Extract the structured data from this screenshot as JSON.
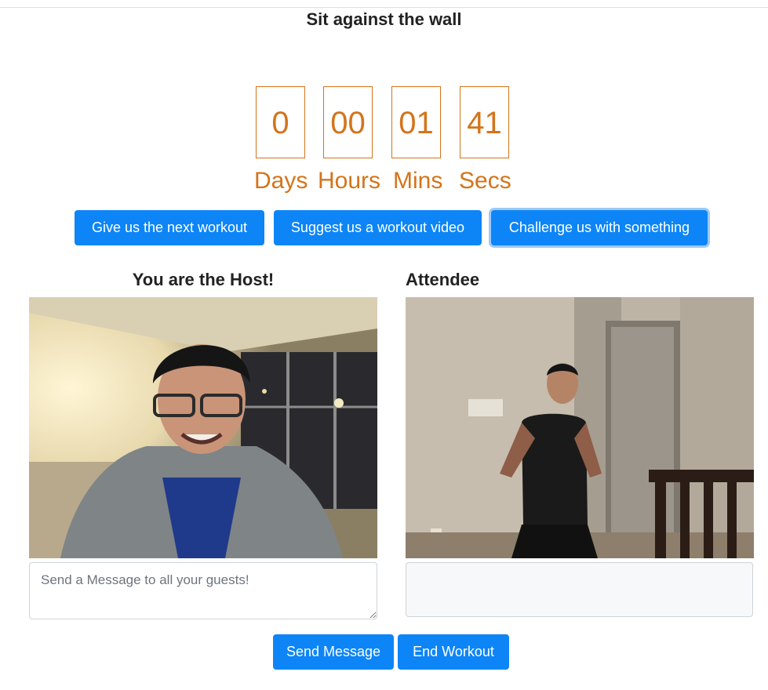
{
  "page": {
    "title": "Sit against the wall"
  },
  "countdown": {
    "days": "0",
    "hours": "00",
    "mins": "01",
    "secs": "41",
    "days_label": "Days",
    "hours_label": "Hours",
    "mins_label": "Mins",
    "secs_label": "Secs",
    "color": "#d4741a"
  },
  "actions": {
    "next_workout": "Give us the next workout",
    "suggest_video": "Suggest us a workout video",
    "challenge": "Challenge us with something"
  },
  "host": {
    "heading": "You are the Host!",
    "message_placeholder": "Send a Message to all your guests!"
  },
  "attendee": {
    "heading": "Attendee",
    "message_value": ""
  },
  "footer": {
    "send_message": "Send Message",
    "end_workout": "End Workout"
  },
  "colors": {
    "primary": "#0d85f7",
    "focus_ring": "#9ccaf9"
  }
}
